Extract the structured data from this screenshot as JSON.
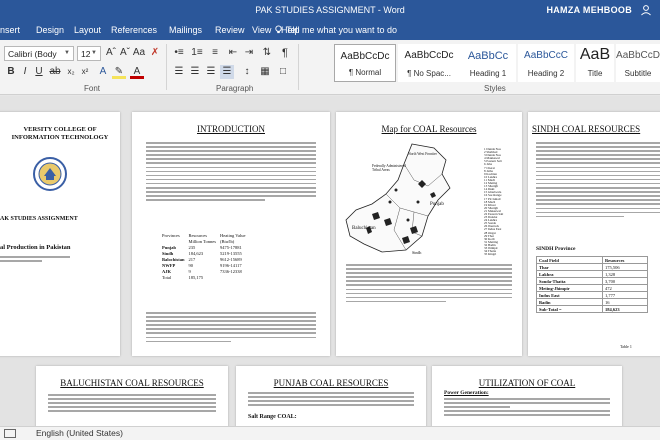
{
  "app": {
    "title": "PAK STUDIES ASSIGNMENT  -  Word",
    "user": "HAMZA MEHBOOB"
  },
  "tabs": [
    "nsert",
    "Design",
    "Layout",
    "References",
    "Mailings",
    "Review",
    "View",
    "Help"
  ],
  "tell_me": "Tell me what you want to do",
  "ribbon": {
    "font_name": "Calibri (Body",
    "font_size": "12",
    "groups": {
      "font": "Font",
      "paragraph": "Paragraph",
      "styles": "Styles"
    },
    "styles": [
      {
        "preview": "AaBbCcDc",
        "name": "¶ Normal"
      },
      {
        "preview": "AaBbCcDc",
        "name": "¶ No Spac..."
      },
      {
        "preview": "AaBbCc",
        "name": "Heading 1"
      },
      {
        "preview": "AaBbCcC",
        "name": "Heading 2"
      },
      {
        "preview": "AaB",
        "name": "Title"
      },
      {
        "preview": "AaBbCcD",
        "name": "Subtitle"
      }
    ]
  },
  "pages": {
    "cover": {
      "college": "VERSITY COLLEGE OF INFORMATION TECHNOLOGY",
      "assignment": "AK STUDIES ASSIGNMENT",
      "topic": "al Production in Pakistan"
    },
    "intro": {
      "title": "INTRODUCTION",
      "table": {
        "headers": [
          "Provinces",
          "Resources",
          "Heating Value"
        ],
        "subheaders": [
          "",
          "Million Tonnes",
          "(Btu/lb)"
        ],
        "rows": [
          [
            "Punjab",
            "235",
            "9475-17881"
          ],
          [
            "Sindh",
            "184,623",
            "5219-13555"
          ],
          [
            "Balochistan",
            "217",
            "9612-15689"
          ],
          [
            "NWFP",
            "90",
            "9196-14117"
          ],
          [
            "AJK",
            "9",
            "7336-12338"
          ]
        ],
        "total_label": "Total",
        "total_value": "185,175"
      }
    },
    "map": {
      "title": "Map for COAL Resources",
      "regions": [
        "North West Frontier",
        "Federally Administered Tribal Areas",
        "Punjab",
        "Baluchistan",
        "Sindh"
      ],
      "legend": [
        "1 Dunda Nos",
        "2 Shahbad",
        "3 Dunda Nos",
        "4 Makkawal",
        "5 Eastern Salt",
        "6 Jaba",
        "7 Cherat",
        "8 Jaiba",
        "9 Kodrian",
        "10 Lakhra",
        "11 Mach",
        "12 Meting",
        "13 Sharigh",
        "14 Duki",
        "15 Ghariwala",
        "16 Sor-Range",
        "17 Pir Ismail",
        "18 Mach",
        "19 Khost",
        "20 Sharigh",
        "21 Makarwal",
        "22 Eastern Salt",
        "23 Dandot",
        "24 Lakhra",
        "25 Sonda",
        "26 Jherruck",
        "27 Indus East",
        "28 Ongar",
        "29 Thar",
        "30 Kotli",
        "31 Metting",
        "32 Badin",
        "33 Jhimpir",
        "34 Thatta",
        "35 Kingri"
      ]
    },
    "sindh": {
      "title": "SINDH COAL RESOURCES",
      "table_title": "SINDH Province",
      "table": {
        "headers": [
          "Coal Field",
          "Resources"
        ],
        "rows": [
          [
            "Thar",
            "175,506"
          ],
          [
            "Lakhra",
            "1,328"
          ],
          [
            "Sonda-Thatta",
            "3,700"
          ],
          [
            "Meting-Jhimpir",
            "472"
          ],
          [
            "Indus East",
            "1,777"
          ],
          [
            "Badin",
            "16"
          ]
        ],
        "total_label": "Sub-Total =",
        "total_value": "184,623"
      },
      "caption": "Table 1"
    },
    "baluchistan": {
      "title": "BALUCHISTAN COAL RESOURCES"
    },
    "punjab": {
      "title": "PUNJAB COAL RESOURCES",
      "subhead": "Salt Range COAL:"
    },
    "utilization": {
      "title": "UTILIZATION OF COAL",
      "subhead": "Power Generation:"
    }
  },
  "status": {
    "language": "English (United States)"
  },
  "colors": {
    "word_blue": "#2b579a",
    "ribbon_bg": "#f3f3f3",
    "doc_bg": "#e3e3e3"
  }
}
